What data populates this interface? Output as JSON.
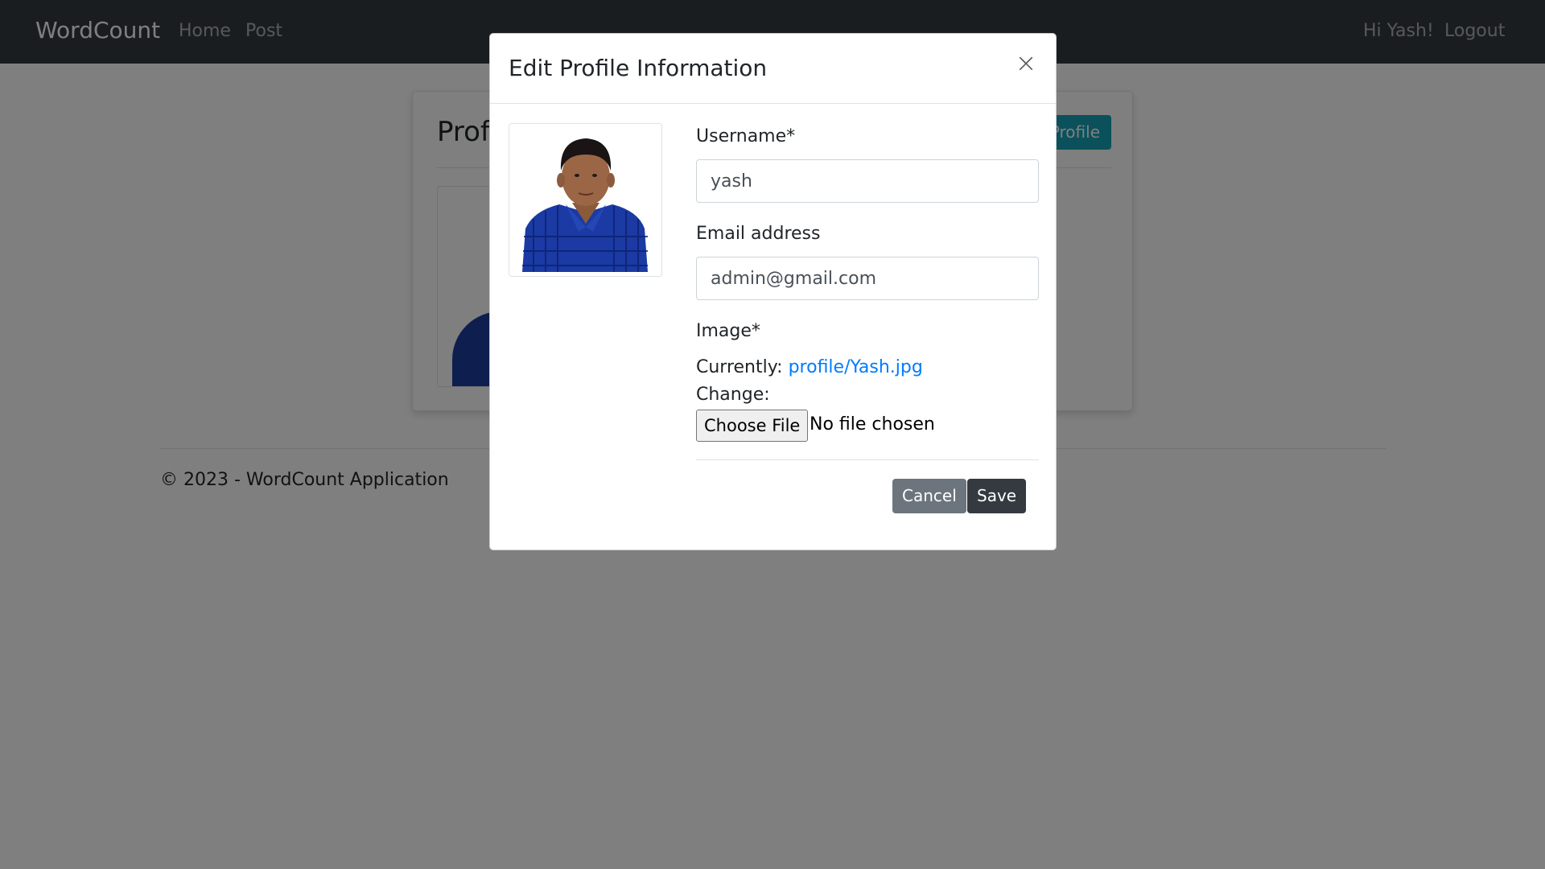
{
  "navbar": {
    "brand": "WordCount",
    "links": [
      "Home",
      "Post"
    ],
    "greeting": "Hi Yash!",
    "logout": "Logout"
  },
  "background_page": {
    "card_title": "Prof",
    "card_button": "Profile",
    "footer": "© 2023 - WordCount Application"
  },
  "modal": {
    "title": "Edit Profile Information",
    "close_symbol": "×",
    "username_label": "Username*",
    "username_value": "yash",
    "email_label": "Email address",
    "email_value": "admin@gmail.com",
    "image_label": "Image*",
    "currently_label": "Currently:",
    "current_file": "profile/Yash.jpg",
    "change_label": "Change:",
    "choose_file_label": "Choose File",
    "file_status": "No file chosen",
    "cancel_label": "Cancel",
    "save_label": "Save"
  },
  "colors": {
    "navbar": "#343a40",
    "primary_link": "#007bff",
    "info": "#17a2b8",
    "secondary": "#6c757d",
    "dark": "#343a40"
  }
}
